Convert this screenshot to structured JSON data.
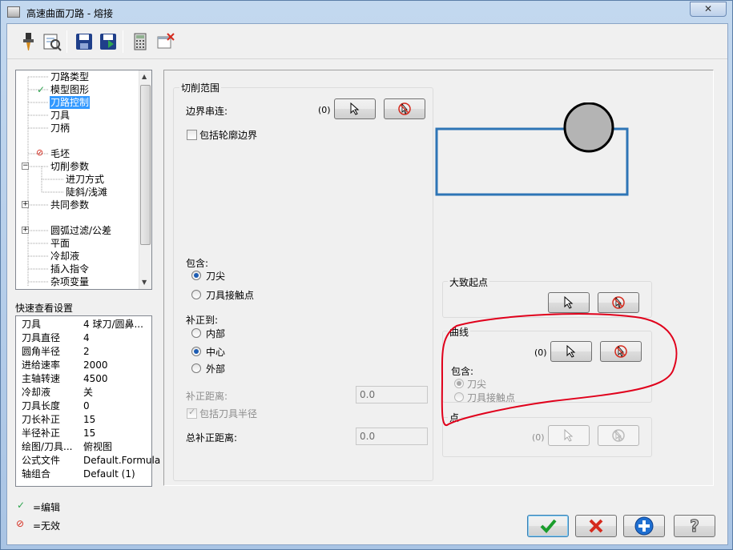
{
  "window": {
    "title": "高速曲面刀路 - 熔接",
    "close_label": "✕"
  },
  "toolbar": {
    "icons": [
      "tool-icon",
      "verify-icon",
      "save-icon",
      "load-icon",
      "calculator-icon",
      "delete-icon"
    ]
  },
  "tree": {
    "items": [
      {
        "label": "刀路类型",
        "status": ""
      },
      {
        "label": "模型图形",
        "status": "edited"
      },
      {
        "label": "刀路控制",
        "status": "",
        "selected": true
      },
      {
        "label": "刀具",
        "status": ""
      },
      {
        "label": "刀柄",
        "status": ""
      },
      {
        "label": "毛坯",
        "status": "disabled"
      },
      {
        "label": "切削参数",
        "status": "",
        "expander": "−"
      },
      {
        "label": "进刀方式",
        "status": ""
      },
      {
        "label": "陡斜/浅滩",
        "status": ""
      },
      {
        "label": "共同参数",
        "status": "",
        "expander": "+"
      },
      {
        "label": "圆弧过滤/公差",
        "status": "",
        "expander": "+"
      },
      {
        "label": "平面",
        "status": ""
      },
      {
        "label": "冷却液",
        "status": ""
      },
      {
        "label": "插入指令",
        "status": ""
      },
      {
        "label": "杂项变量",
        "status": ""
      }
    ]
  },
  "quick_view": {
    "title": "快速查看设置",
    "rows": [
      {
        "key": "刀具",
        "value": "4 球刀/圆鼻..."
      },
      {
        "key": "刀具直径",
        "value": "4"
      },
      {
        "key": "圆角半径",
        "value": "2"
      },
      {
        "key": "进给速率",
        "value": "2000"
      },
      {
        "key": "主轴转速",
        "value": "4500"
      },
      {
        "key": "冷却液",
        "value": "关"
      },
      {
        "key": "刀具长度",
        "value": "0"
      },
      {
        "key": "刀长补正",
        "value": "15"
      },
      {
        "key": "半径补正",
        "value": "15"
      },
      {
        "key": "绘图/刀具...",
        "value": "俯视图"
      },
      {
        "key": "公式文件",
        "value": "Default.Formula"
      },
      {
        "key": "轴组合",
        "value": "Default (1)"
      }
    ]
  },
  "legend": {
    "edited": "=编辑",
    "disabled": "=无效"
  },
  "cut_range": {
    "group_label": "切削范围",
    "boundary_label": "边界串连:",
    "boundary_count": "(0)",
    "include_contour_label": "包括轮廓边界",
    "include_label": "包含:",
    "include_options": [
      "刀尖",
      "刀具接触点"
    ],
    "include_selected": "刀尖",
    "comp_to_label": "补正到:",
    "comp_to_options": [
      "内部",
      "中心",
      "外部"
    ],
    "comp_to_selected": "中心",
    "comp_dist_label": "补正距离:",
    "comp_dist_value": "0.0",
    "include_tool_radius_label": "包括刀具半径",
    "total_comp_label": "总补正距离:",
    "total_comp_value": "0.0"
  },
  "start_point": {
    "group_label": "大致起点"
  },
  "curve": {
    "group_label": "曲线",
    "count": "(0)",
    "include_label": "包含:",
    "options": [
      "刀尖",
      "刀具接触点"
    ],
    "selected": "刀尖"
  },
  "point": {
    "group_label": "点",
    "count": "(0)"
  },
  "colors": {
    "preview_rect": "#2e75b6",
    "preview_circle_fill": "#b4b4b4",
    "annotation": "#e0001b"
  }
}
